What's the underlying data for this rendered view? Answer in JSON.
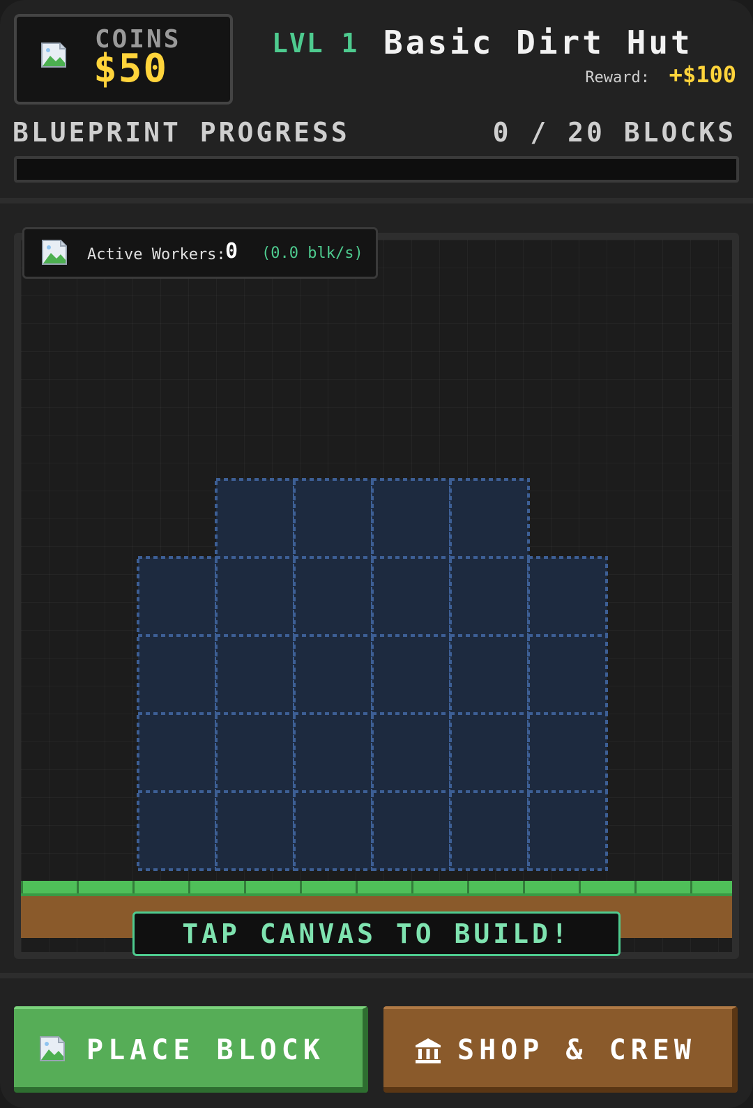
{
  "header": {
    "coins_label": "COINS",
    "coins_value": "$50",
    "level_tag": "LVL 1",
    "building_name": "Basic Dirt Hut",
    "reward_label": "Reward:",
    "reward_value": "+$100"
  },
  "progress": {
    "label": "BLUEPRINT PROGRESS",
    "count_text": "0 / 20 BLOCKS",
    "placed": 0,
    "total": 20,
    "fraction": 0.0
  },
  "workers": {
    "label": "Active Workers:",
    "count": "0",
    "rate": "(0.0 blk/s)"
  },
  "canvas": {
    "hint": "TAP CANVAS TO BUILD!",
    "blueprint_rows": [
      [
        0,
        1,
        1,
        1,
        1,
        0
      ],
      [
        1,
        1,
        1,
        1,
        1,
        1
      ],
      [
        1,
        1,
        1,
        1,
        1,
        1
      ],
      [
        1,
        1,
        1,
        1,
        1,
        1
      ],
      [
        1,
        1,
        1,
        1,
        1,
        1
      ]
    ]
  },
  "actions": {
    "place_label": "PLACE BLOCK",
    "shop_label": "SHOP & CREW"
  },
  "colors": {
    "accent_green": "#4ecb8f",
    "gold": "#ffd43b",
    "blueprint_fill": "#1d2a3f",
    "blueprint_stroke": "#3d5f95",
    "grass": "#4fbf59",
    "dirt": "#8a5a2b"
  },
  "icons": {
    "coins": "broken-image-icon",
    "workers": "broken-image-icon",
    "place_block": "broken-image-icon",
    "shop": "bank-icon"
  }
}
